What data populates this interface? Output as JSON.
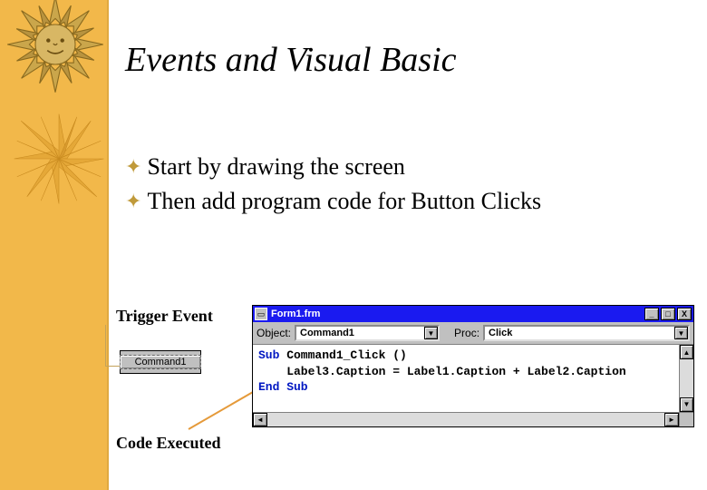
{
  "title": "Events and Visual Basic",
  "bullets": [
    "Start by drawing the screen",
    "Then add program code for Button Clicks"
  ],
  "left": {
    "trigger_label": "Trigger Event",
    "button_caption": "Command1",
    "exec_label": "Code Executed"
  },
  "codewin": {
    "title": "Form1.frm",
    "object_label": "Object:",
    "object_value": "Command1",
    "proc_label": "Proc:",
    "proc_value": "Click",
    "code": {
      "line1_kw": "Sub",
      "line1_rest": " Command1_Click ()",
      "line2": "    Label3.Caption = Label1.Caption + Label2.Caption",
      "line3_kw": "End Sub"
    },
    "glyphs": {
      "min": "_",
      "max": "□",
      "close": "X",
      "down": "▼",
      "up": "▲",
      "left": "◄",
      "right": "►"
    }
  }
}
